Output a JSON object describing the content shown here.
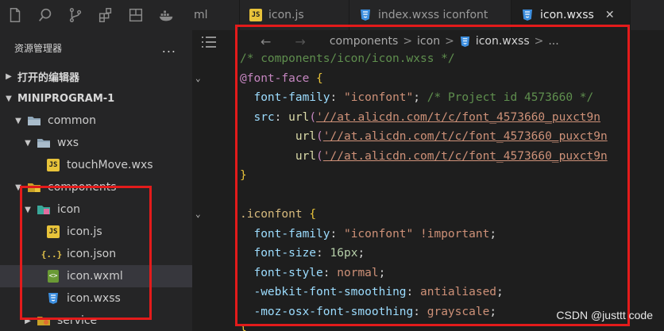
{
  "activity": {
    "icons": [
      "files-icon",
      "search-icon",
      "source-control-icon",
      "extensions-icon",
      "remote-icon",
      "docker-icon"
    ]
  },
  "tabs": [
    {
      "label": "ml",
      "kind": "partial"
    },
    {
      "label": "icon.js",
      "kind": "js"
    },
    {
      "label": "index.wxss iconfont",
      "kind": "css"
    },
    {
      "label": "icon.wxss",
      "kind": "css",
      "active": true,
      "close": "✕"
    }
  ],
  "sidebar": {
    "title": "资源管理器",
    "more": "...",
    "open_editors": "打开的编辑器",
    "project": "MINIPROGRAM-1",
    "tree": [
      {
        "label": "common",
        "type": "folder",
        "depth": 1,
        "open": true
      },
      {
        "label": "wxs",
        "type": "folder",
        "depth": 2,
        "open": true
      },
      {
        "label": "touchMove.wxs",
        "type": "js",
        "depth": 3
      },
      {
        "label": "components",
        "type": "folder-special",
        "depth": 1,
        "open": true
      },
      {
        "label": "icon",
        "type": "folder-special",
        "depth": 2,
        "open": true
      },
      {
        "label": "icon.js",
        "type": "js",
        "depth": 3
      },
      {
        "label": "icon.json",
        "type": "json",
        "depth": 3
      },
      {
        "label": "icon.wxml",
        "type": "wxml",
        "depth": 3,
        "selected": true
      },
      {
        "label": "icon.wxss",
        "type": "css",
        "depth": 3
      },
      {
        "label": "service",
        "type": "folder-special",
        "depth": 1,
        "open": false
      }
    ]
  },
  "breadcrumb": {
    "back": "←",
    "forward": "→",
    "parts": [
      "components",
      "icon",
      "icon.wxss",
      "..."
    ],
    "sep": ">"
  },
  "code": {
    "comment": "/* components/icon/icon.wxss */",
    "font_face": "@font-face",
    "ff_prop": "font-family",
    "ff_value": "\"iconfont\"",
    "ff_comment": "/* Project id 4573660 */",
    "src_prop": "src",
    "url_fn": "url",
    "url1": "'//at.alicdn.com/t/c/font_4573660_puxct9n",
    "url2": "'//at.alicdn.com/t/c/font_4573660_puxct9n",
    "url3": "'//at.alicdn.com/t/c/font_4573660_puxct9n",
    "close_brace": "}",
    "open_brace": "{",
    "selector": ".iconfont",
    "p1": "font-family",
    "v1": "\"iconfont\"",
    "v1b": "!important",
    "p2": "font-size",
    "v2": "16px",
    "p3": "font-style",
    "v3": "normal",
    "p4": "-webkit-font-smoothing",
    "v4": "antialiased",
    "p5": "-moz-osx-font-smoothing",
    "v5": "grayscale",
    "last": "}"
  },
  "watermark": "CSDN @justtt code",
  "colors": {
    "highlight": "#e31b1b",
    "js_badge": "#e8c33a",
    "css_icon": "#3d8fe0"
  }
}
